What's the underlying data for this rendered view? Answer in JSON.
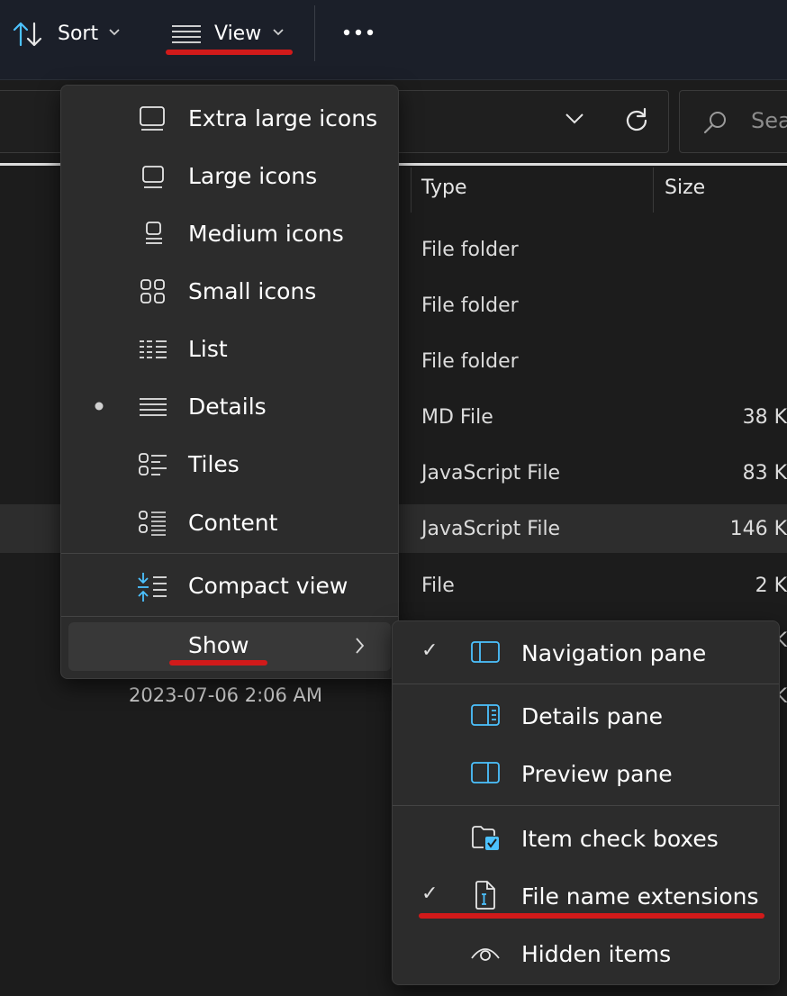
{
  "toolbar": {
    "sort_label": "Sort",
    "view_label": "View",
    "more_label": "•••"
  },
  "search": {
    "placeholder": "Sea"
  },
  "columns": {
    "type": "Type",
    "size": "Size"
  },
  "files": [
    {
      "type": "File folder",
      "size": ""
    },
    {
      "type": "File folder",
      "size": ""
    },
    {
      "type": "File folder",
      "size": ""
    },
    {
      "type": "MD File",
      "size": "38 K"
    },
    {
      "type": "JavaScript File",
      "size": "83 K"
    },
    {
      "type": "JavaScript File",
      "size": "146 K"
    },
    {
      "type": "File",
      "size": "2 K"
    },
    {
      "type": "",
      "size": "K"
    },
    {
      "type": "",
      "size": "K"
    }
  ],
  "date_modified": "2023-07-06 2:06 AM",
  "view_menu": {
    "items": [
      {
        "label": "Extra large icons",
        "icon": "extra-large-icons-icon"
      },
      {
        "label": "Large icons",
        "icon": "large-icons-icon"
      },
      {
        "label": "Medium icons",
        "icon": "medium-icons-icon"
      },
      {
        "label": "Small icons",
        "icon": "small-icons-icon"
      },
      {
        "label": "List",
        "icon": "list-icon"
      },
      {
        "label": "Details",
        "icon": "details-icon",
        "selected": true
      },
      {
        "label": "Tiles",
        "icon": "tiles-icon"
      },
      {
        "label": "Content",
        "icon": "content-icon"
      }
    ],
    "compact_label": "Compact view",
    "show_label": "Show"
  },
  "show_menu": {
    "items": [
      {
        "label": "Navigation pane",
        "checked": true,
        "icon": "navigation-pane-icon"
      },
      {
        "label": "Details pane",
        "checked": false,
        "icon": "details-pane-icon"
      },
      {
        "label": "Preview pane",
        "checked": false,
        "icon": "preview-pane-icon"
      },
      {
        "label": "Item check boxes",
        "checked": false,
        "icon": "item-check-boxes-icon"
      },
      {
        "label": "File name extensions",
        "checked": true,
        "icon": "file-name-extensions-icon"
      },
      {
        "label": "Hidden items",
        "checked": false,
        "icon": "hidden-items-icon"
      }
    ],
    "check_glyph": "✓"
  },
  "colors": {
    "accent": "#4cc2ff",
    "annotation": "#d11a1a"
  }
}
